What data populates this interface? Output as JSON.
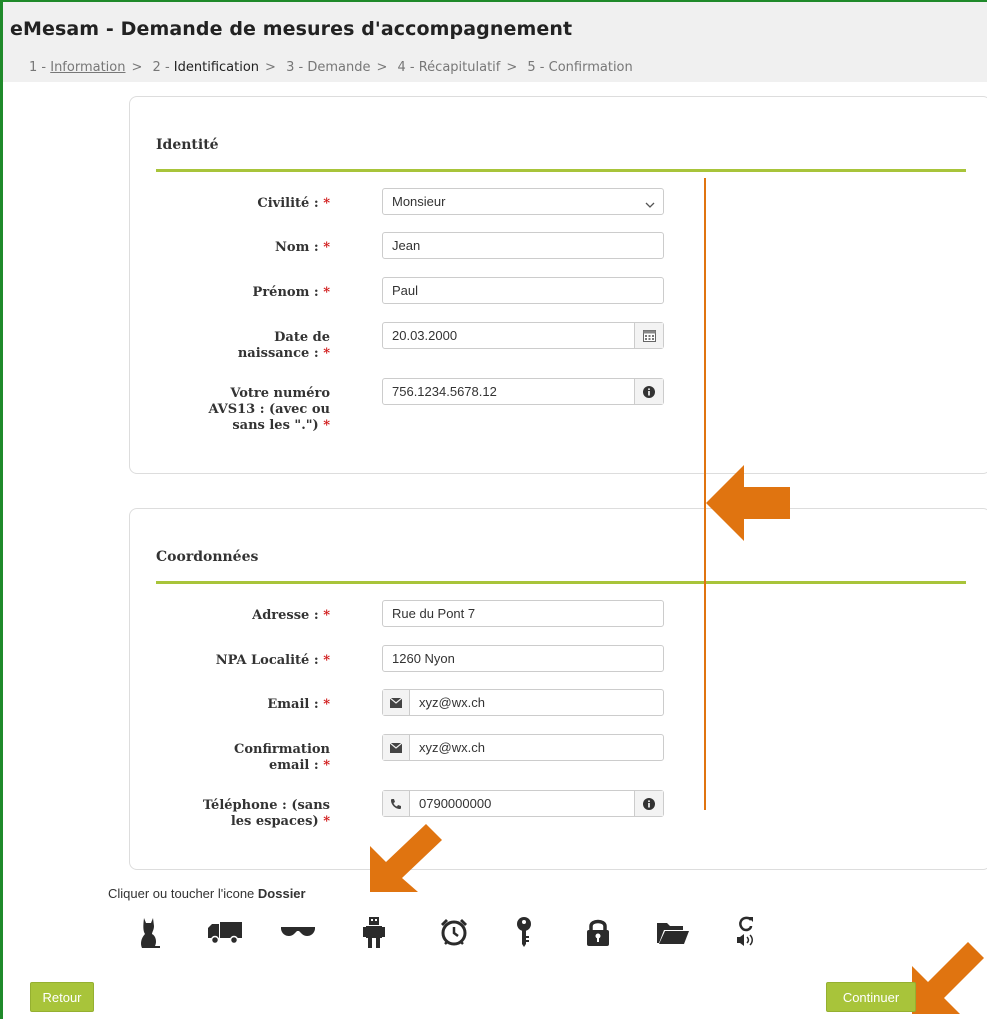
{
  "header": {
    "title": "eMesam - Demande de mesures d'accompagnement",
    "steps": [
      {
        "num": "1 - ",
        "label": "Information"
      },
      {
        "num": "2 - ",
        "label": "Identification"
      },
      {
        "num": "3 - ",
        "label": "Demande"
      },
      {
        "num": "4 - ",
        "label": "Récapitulatif"
      },
      {
        "num": "5 - ",
        "label": "Confirmation"
      }
    ],
    "separator": ">"
  },
  "identity": {
    "title": "Identité",
    "civilite": {
      "label": "Civilité :",
      "value": "Monsieur"
    },
    "nom": {
      "label": "Nom :",
      "value": "Jean"
    },
    "prenom": {
      "label": "Prénom :",
      "value": "Paul"
    },
    "naissance": {
      "label1": "Date de",
      "label2": "naissance :",
      "value": "20.03.2000"
    },
    "avs": {
      "label1": "Votre numéro",
      "label2": "AVS13 : (avec ou",
      "label3": "sans les \".\")",
      "value": "756.1234.5678.12"
    }
  },
  "contact": {
    "title": "Coordonnées",
    "adresse": {
      "label": "Adresse :",
      "value": "Rue du Pont 7"
    },
    "npa": {
      "label": "NPA Localité :",
      "value": "1260 Nyon"
    },
    "email": {
      "label": "Email :",
      "value": "xyz@wx.ch"
    },
    "confirm": {
      "label1": "Confirmation",
      "label2": "email :",
      "value": "xyz@wx.ch"
    },
    "tel": {
      "label1": "Téléphone : (sans",
      "label2": "les espaces)",
      "value": "0790000000"
    }
  },
  "required_mark": "*",
  "captcha": {
    "hint_prefix": "Cliquer ou toucher l'icone ",
    "hint_target": "Dossier",
    "icons": [
      "cat-icon",
      "truck-icon",
      "sunglasses-icon",
      "robot-icon",
      "alarm-clock-icon",
      "key-icon",
      "lock-icon",
      "folder-icon",
      "audio-refresh-icon"
    ]
  },
  "buttons": {
    "back": "Retour",
    "continue": "Continuer"
  },
  "colors": {
    "accent_green": "#a8c43a",
    "annotation_orange": "#e07410",
    "frame_green": "#1f8a2a",
    "required_red": "#d01818"
  }
}
